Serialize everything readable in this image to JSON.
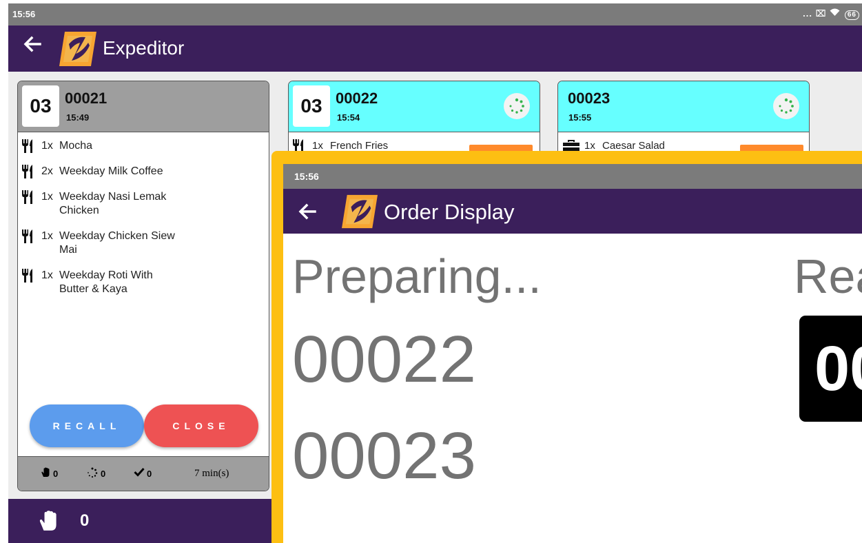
{
  "device": {
    "time": "15:56",
    "system_icons": "...",
    "battery": "66"
  },
  "expeditor": {
    "title": "Expeditor",
    "orders": [
      {
        "seat": "03",
        "number": "00021",
        "time": "15:49",
        "header_color": "#9e9e9e",
        "items": [
          {
            "qty": "1x",
            "name": "Mocha"
          },
          {
            "qty": "2x",
            "name": "Weekday Milk Coffee"
          },
          {
            "qty": "1x",
            "name": "Weekday Nasi Lemak Chicken"
          },
          {
            "qty": "1x",
            "name": "Weekday Chicken Siew Mai"
          },
          {
            "qty": "1x",
            "name": "Weekday Roti With Butter & Kaya"
          }
        ],
        "recall_label": "RECALL",
        "close_label": "CLOSE",
        "footer": {
          "on_hold": "0",
          "preparing": "0",
          "done": "0",
          "elapsed": "7 min(s)"
        }
      },
      {
        "seat": "03",
        "number": "00022",
        "time": "15:54",
        "header_color": "#66ffff",
        "items": [
          {
            "qty": "1x",
            "name": "French Fries"
          }
        ]
      },
      {
        "seat": "",
        "number": "00023",
        "time": "15:55",
        "header_color": "#66ffff",
        "items": [
          {
            "qty": "1x",
            "name": "Caesar Salad"
          }
        ]
      }
    ],
    "bottom_bar": {
      "on_hold_count": "0"
    }
  },
  "order_display": {
    "time": "15:56",
    "title": "Order Display",
    "preparing_heading": "Preparing...",
    "preparing_orders": [
      "00022",
      "00023"
    ],
    "ready_heading": "Rea",
    "ready_order_visible": "00"
  },
  "colors": {
    "primary": "#3b1f5b",
    "status_bar": "#7b7b7b",
    "accent_yellow": "#fdbf12",
    "recall": "#5c9ced",
    "close": "#ee5253",
    "orange": "#ff8a2b",
    "in_progress_header": "#66ffff"
  }
}
